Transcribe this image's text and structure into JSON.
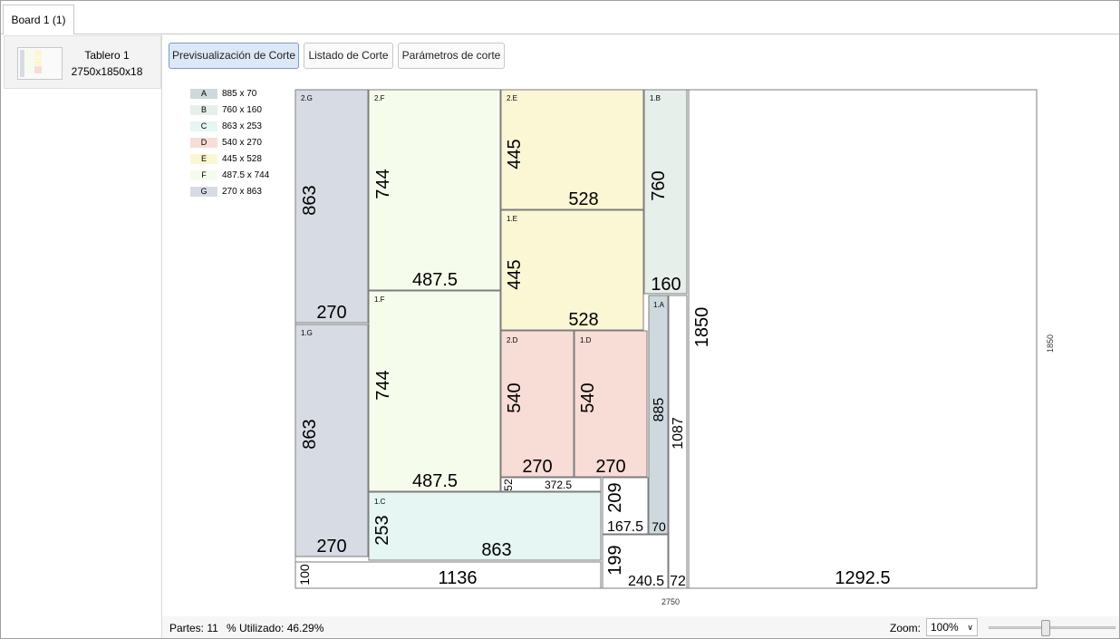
{
  "tabs": [
    {
      "label": "Board 1 (1)"
    }
  ],
  "sidebar": {
    "board": {
      "name": "Tablero 1",
      "size": "2750x1850x18"
    }
  },
  "toolbar": {
    "preview_label": "Previsualización de Corte",
    "list_label": "Listado de Corte",
    "params_label": "Parámetros de corte"
  },
  "colors": {
    "A": "#cdd9dd",
    "B": "#e7efea",
    "C": "#e6f6f3",
    "D": "#f8dcd6",
    "E": "#fbf7d5",
    "F": "#f6fcec",
    "G": "#d7dbe3",
    "accent": "#dce8f5"
  },
  "legend": [
    {
      "code": "A",
      "dim": "885 x 70"
    },
    {
      "code": "B",
      "dim": "760 x 160"
    },
    {
      "code": "C",
      "dim": "863 x 253"
    },
    {
      "code": "D",
      "dim": "540 x 270"
    },
    {
      "code": "E",
      "dim": "445 x 528"
    },
    {
      "code": "F",
      "dim": "487.5 x 744"
    },
    {
      "code": "G",
      "dim": "270 x 863"
    }
  ],
  "board": {
    "width_label": "2750",
    "height_label": "1850"
  },
  "pieces": [
    {
      "id": "2.G",
      "w": "270",
      "h": "863"
    },
    {
      "id": "1.G",
      "w": "270",
      "h": "863"
    },
    {
      "id": "2.F",
      "w": "487.5",
      "h": "744"
    },
    {
      "id": "1.F",
      "w": "487.5",
      "h": "744"
    },
    {
      "id": "2.E",
      "w": "528",
      "h": "445"
    },
    {
      "id": "1.E",
      "w": "528",
      "h": "445"
    },
    {
      "id": "1.B",
      "w": "160",
      "h": "760"
    },
    {
      "id": "2.D",
      "w": "270",
      "h": "540"
    },
    {
      "id": "1.D",
      "w": "270",
      "h": "540"
    },
    {
      "id": "1.A",
      "w": "70",
      "h": "885"
    },
    {
      "id": "1.C",
      "w": "863",
      "h": "253"
    }
  ],
  "waste": [
    {
      "w": "1136",
      "h": "100"
    },
    {
      "w": "372.5",
      "h": "52"
    },
    {
      "w": "167.5",
      "h": "209"
    },
    {
      "w": "240.5",
      "h": "199"
    },
    {
      "w": "72",
      "h": "1087"
    },
    {
      "w": "1292.5",
      "h": "1850"
    }
  ],
  "status": {
    "parts": "Partes: 11",
    "used": "% Utilizado: 46.29%",
    "zoom_label": "Zoom:",
    "zoom_value": "100%"
  }
}
